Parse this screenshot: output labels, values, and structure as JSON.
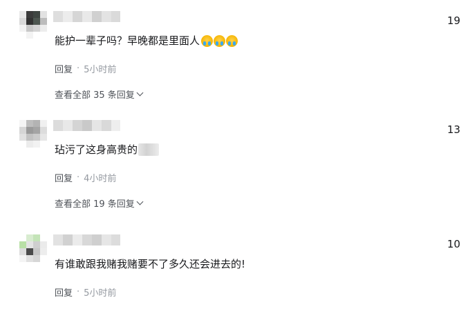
{
  "comments": [
    {
      "text": "能护一辈子吗？早晚都是里面人",
      "emojis": [
        "crying-emoji",
        "crying-emoji",
        "crying-emoji"
      ],
      "reply_label": "回复",
      "separator": "·",
      "time": "5小时前",
      "view_replies": "查看全部 35 条回复",
      "side_number": "19"
    },
    {
      "text": "玷污了这身高贵的",
      "reply_label": "回复",
      "separator": "·",
      "time": "4小时前",
      "view_replies": "查看全部 19 条回复",
      "side_number": "13."
    },
    {
      "text": "有谁敢跟我赌我赌要不了多久还会进去的!",
      "reply_label": "回复",
      "separator": "·",
      "time": "5小时前",
      "side_number": "10("
    }
  ],
  "colors": {
    "text": "#18191c",
    "meta": "#61666d",
    "muted": "#9499a0"
  }
}
